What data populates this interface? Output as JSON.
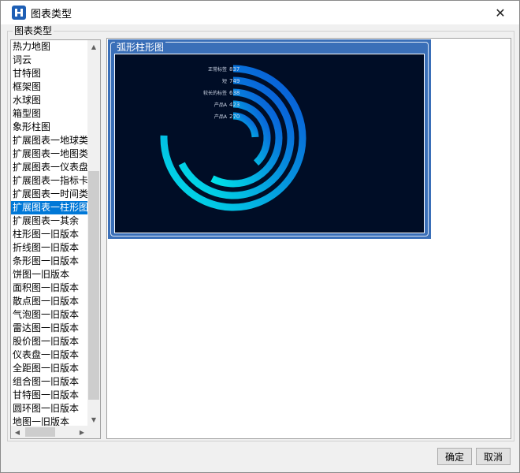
{
  "dialog": {
    "title": "图表类型",
    "close_glyph": "✕",
    "app_icon": "app-logo-icon",
    "group_label": "图表类型"
  },
  "chart_type_list": {
    "selected_index": 14,
    "items": [
      {
        "label": "热力地图"
      },
      {
        "label": "词云"
      },
      {
        "label": "甘特图"
      },
      {
        "label": "框架图"
      },
      {
        "label": "水球图"
      },
      {
        "label": "箱型图"
      },
      {
        "label": "象形柱图"
      },
      {
        "label": "扩展图表一地球类"
      },
      {
        "label": "扩展图表一地图类"
      },
      {
        "label": "扩展图表一仪表盘"
      },
      {
        "label": "扩展图表一指标卡"
      },
      {
        "label": "扩展图表一时间类"
      },
      {
        "label": "扩展图表一柱形图"
      },
      {
        "label": "扩展图表一其余"
      },
      {
        "label": "柱形图一旧版本"
      },
      {
        "label": "折线图一旧版本"
      },
      {
        "label": "条形图一旧版本"
      },
      {
        "label": "饼图一旧版本"
      },
      {
        "label": "面积图一旧版本"
      },
      {
        "label": "散点图一旧版本"
      },
      {
        "label": "气泡图一旧版本"
      },
      {
        "label": "雷达图一旧版本"
      },
      {
        "label": "股价图一旧版本"
      },
      {
        "label": "仪表盘一旧版本"
      },
      {
        "label": "全距图一旧版本"
      },
      {
        "label": "组合图一旧版本"
      },
      {
        "label": "甘特图一旧版本"
      },
      {
        "label": "圆环图一旧版本"
      },
      {
        "label": "地图一旧版本"
      }
    ]
  },
  "preview": {
    "card_title": "弧形柱形图"
  },
  "chart_data": {
    "type": "radial-bar",
    "title": "弧形柱形图",
    "categories": [
      "正常标签",
      "短",
      "较长的标签",
      "产品A",
      "产品A"
    ],
    "values": [
      837,
      749,
      638,
      423,
      270
    ],
    "colors": {
      "start": "#00e5e8",
      "end": "#0a4fd6",
      "background": "#000d26",
      "label": "#cfd8e8"
    }
  },
  "buttons": {
    "ok": "确定",
    "cancel": "取消"
  }
}
